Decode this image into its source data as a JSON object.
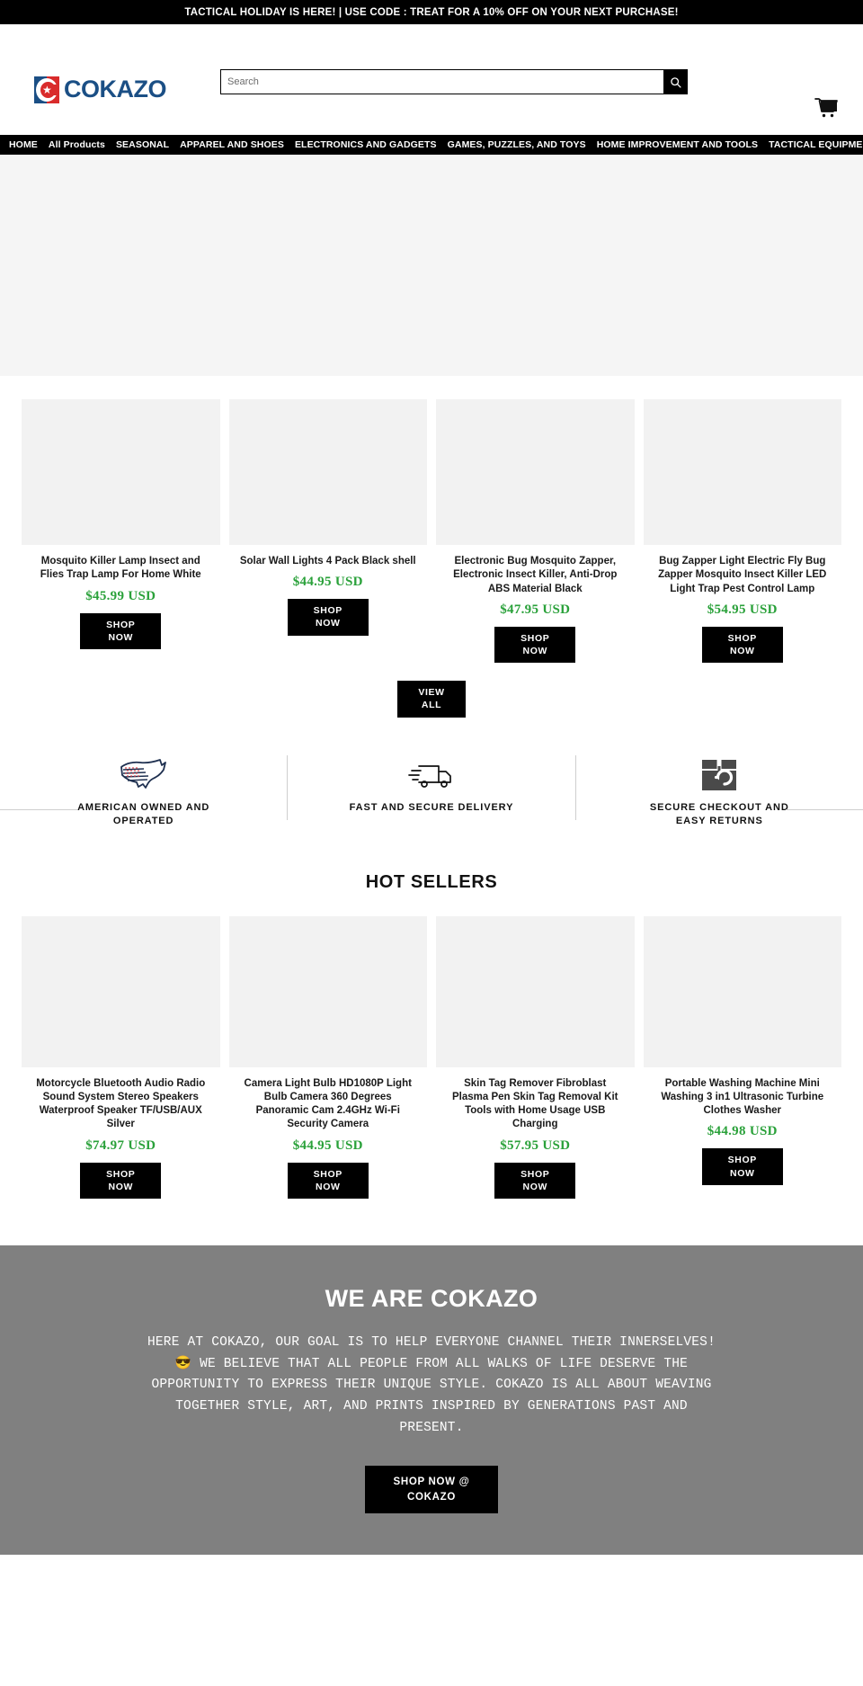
{
  "announcement": {
    "text": "TACTICAL HOLIDAY IS HERE! | USE CODE : TREAT FOR A 10% OFF ON YOUR NEXT PURCHASE!"
  },
  "header": {
    "logo_text": "COKAZO",
    "logo_mark_icon": "flag-star-icon",
    "search": {
      "placeholder": "Search",
      "value": "",
      "button_icon": "search-icon"
    },
    "cart_icon": "shopping-cart-icon"
  },
  "nav": {
    "items": [
      {
        "label": "HOME"
      },
      {
        "label": "All Products"
      },
      {
        "label": "SEASONAL"
      },
      {
        "label": "APPAREL AND SHOES"
      },
      {
        "label": "ELECTRONICS AND GADGETS"
      },
      {
        "label": "GAMES, PUZZLES, AND TOYS"
      },
      {
        "label": "HOME IMPROVEMENT AND TOOLS"
      },
      {
        "label": "TACTICAL EQUIPMENT"
      }
    ]
  },
  "hero": {
    "background_color": "#f5f5f5"
  },
  "featured_products": {
    "items": [
      {
        "title": "Mosquito Killer Lamp Insect and Flies Trap Lamp For Home White",
        "price": "$45.99 USD",
        "cta_line1": "SHOP",
        "cta_line2": "NOW"
      },
      {
        "title": "Solar Wall Lights 4 Pack Black shell",
        "price": "$44.95 USD",
        "cta_line1": "SHOP",
        "cta_line2": "NOW"
      },
      {
        "title": "Electronic Bug Mosquito Zapper, Electronic Insect Killer, Anti-Drop ABS Material Black",
        "price": "$47.95 USD",
        "cta_line1": "SHOP",
        "cta_line2": "NOW"
      },
      {
        "title": "Bug Zapper Light Electric Fly Bug Zapper Mosquito Insect Killer LED Light Trap Pest Control Lamp",
        "price": "$54.95 USD",
        "cta_line1": "SHOP",
        "cta_line2": "NOW"
      }
    ],
    "view_all_line1": "VIEW",
    "view_all_line2": "ALL"
  },
  "features": {
    "items": [
      {
        "icon": "usa-map-icon",
        "label": "AMERICAN OWNED AND OPERATED"
      },
      {
        "icon": "delivery-truck-icon",
        "label": "FAST AND SECURE DELIVERY"
      },
      {
        "icon": "return-box-icon",
        "label": "SECURE CHECKOUT AND EASY RETURNS"
      }
    ]
  },
  "hot_sellers": {
    "title": "HOT SELLERS",
    "items": [
      {
        "title": "Motorcycle Bluetooth Audio Radio Sound System Stereo Speakers Waterproof Speaker TF/USB/AUX Silver",
        "price": "$74.97 USD",
        "cta_line1": "SHOP",
        "cta_line2": "NOW"
      },
      {
        "title": "Camera Light Bulb HD1080P Light Bulb Camera 360 Degrees Panoramic Cam 2.4GHz Wi-Fi Security Camera",
        "price": "$44.95 USD",
        "cta_line1": "SHOP",
        "cta_line2": "NOW"
      },
      {
        "title": "Skin Tag Remover Fibroblast Plasma Pen Skin Tag Removal Kit Tools with Home Usage USB Charging",
        "price": "$57.95 USD",
        "cta_line1": "SHOP",
        "cta_line2": "NOW"
      },
      {
        "title": "Portable Washing Machine Mini Washing 3 in1 Ultrasonic Turbine Clothes Washer",
        "price": "$44.98 USD",
        "cta_line1": "SHOP",
        "cta_line2": "NOW"
      }
    ]
  },
  "about": {
    "heading": "WE ARE COKAZO",
    "body": "HERE AT COKAZO, OUR GOAL IS TO HELP EVERYONE CHANNEL THEIR INNERSELVES! 😎 WE BELIEVE THAT ALL PEOPLE FROM ALL WALKS OF LIFE DESERVE THE OPPORTUNITY TO EXPRESS THEIR UNIQUE STYLE. COKAZO IS ALL ABOUT WEAVING TOGETHER STYLE, ART, AND PRINTS INSPIRED BY GENERATIONS PAST AND PRESENT.",
    "cta_line1": "SHOP NOW @",
    "cta_line2": "COKAZO",
    "background_color": "#808080"
  },
  "colors": {
    "price_green": "#2aa13a",
    "logo_blue": "#1b4f85",
    "logo_red": "#d92b2b",
    "black": "#000000"
  }
}
